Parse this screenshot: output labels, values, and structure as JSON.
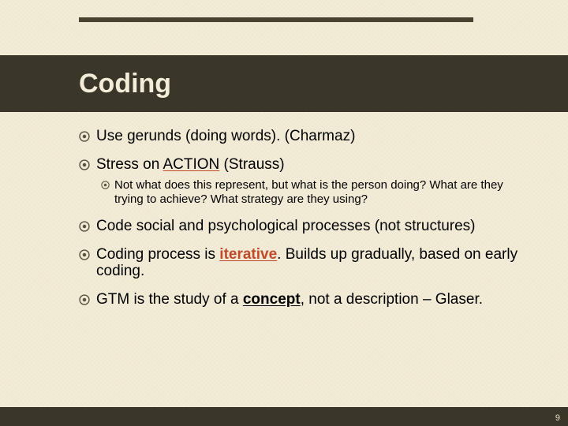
{
  "title": "Coding",
  "bullets": [
    {
      "text": "Use gerunds (doing words). (Charmaz)"
    },
    {
      "text_html": "Stress on <span class='emph'>ACTION</span> (Strauss)",
      "sub": [
        {
          "text": "Not what does this represent, but what is the person doing? What are they trying to achieve? What strategy are they using?"
        }
      ]
    },
    {
      "text": "Code social and psychological processes (not structures)"
    },
    {
      "text_html": "Coding process is <span class='iter'>iterative</span>. Builds up gradually, based on early coding."
    },
    {
      "text_html": "GTM is the study of a <span class='concept'>concept</span>, not a description – Glaser."
    }
  ],
  "page_number": "9",
  "icon_color": "#595340"
}
